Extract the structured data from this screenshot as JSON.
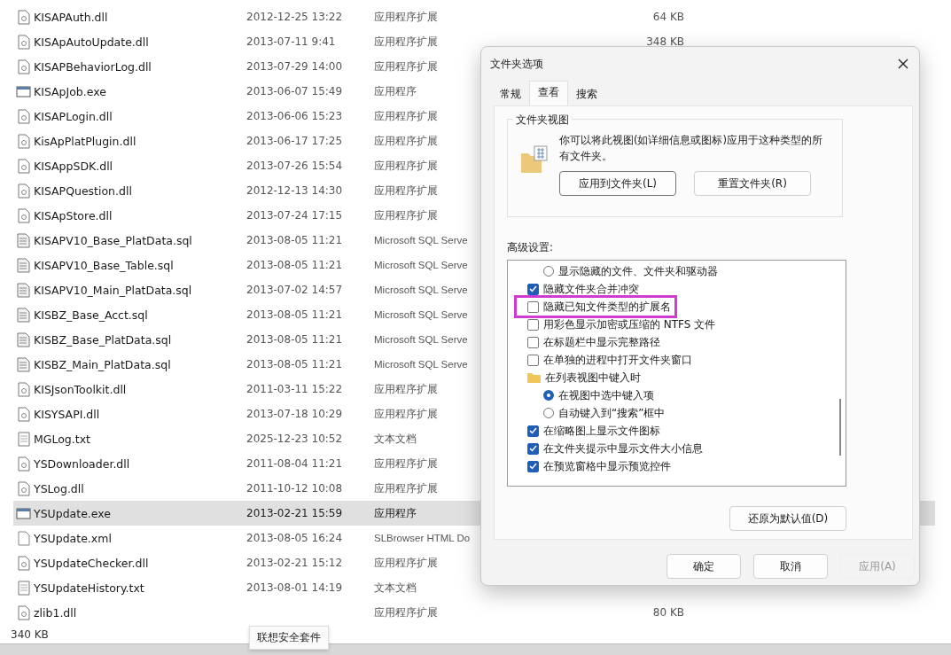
{
  "files": [
    {
      "name": "KISAPAuth.dll",
      "kind": "dll",
      "date": "2012-12-25 13:22",
      "type": "应用程序扩展",
      "size": "64 KB",
      "selected": false
    },
    {
      "name": "KISApAutoUpdate.dll",
      "kind": "dll",
      "date": "2013-07-11 9:41",
      "type": "应用程序扩展",
      "size": "348 KB",
      "selected": false
    },
    {
      "name": "KISAPBehaviorLog.dll",
      "kind": "dll",
      "date": "2013-07-29 14:00",
      "type": "应用程序扩展",
      "selected": false
    },
    {
      "name": "KISApJob.exe",
      "kind": "exe",
      "date": "2013-06-07 15:49",
      "type": "应用程序",
      "selected": false
    },
    {
      "name": "KISAPLogin.dll",
      "kind": "dll",
      "date": "2013-06-06 15:23",
      "type": "应用程序扩展",
      "selected": false
    },
    {
      "name": "KisApPlatPlugin.dll",
      "kind": "dll",
      "date": "2013-06-17 17:25",
      "type": "应用程序扩展",
      "selected": false
    },
    {
      "name": "KISAppSDK.dll",
      "kind": "dll",
      "date": "2013-07-26 15:54",
      "type": "应用程序扩展",
      "selected": false
    },
    {
      "name": "KISAPQuestion.dll",
      "kind": "dll",
      "date": "2012-12-13 14:30",
      "type": "应用程序扩展",
      "selected": false
    },
    {
      "name": "KISApStore.dll",
      "kind": "dll",
      "date": "2013-07-24 17:15",
      "type": "应用程序扩展",
      "selected": false
    },
    {
      "name": "KISAPV10_Base_PlatData.sql",
      "kind": "sql",
      "date": "2013-08-05 11:21",
      "type": "Microsoft SQL Serve",
      "selected": false
    },
    {
      "name": "KISAPV10_Base_Table.sql",
      "kind": "sql",
      "date": "2013-08-05 11:21",
      "type": "Microsoft SQL Serve",
      "selected": false
    },
    {
      "name": "KISAPV10_Main_PlatData.sql",
      "kind": "sql",
      "date": "2013-07-02 14:57",
      "type": "Microsoft SQL Serve",
      "selected": false
    },
    {
      "name": "KISBZ_Base_Acct.sql",
      "kind": "sql",
      "date": "2013-08-05 11:21",
      "type": "Microsoft SQL Serve",
      "selected": false
    },
    {
      "name": "KISBZ_Base_PlatData.sql",
      "kind": "sql",
      "date": "2013-08-05 11:21",
      "type": "Microsoft SQL Serve",
      "selected": false
    },
    {
      "name": "KISBZ_Main_PlatData.sql",
      "kind": "sql",
      "date": "2013-08-05 11:21",
      "type": "Microsoft SQL Serve",
      "selected": false
    },
    {
      "name": "KISJsonToolkit.dll",
      "kind": "dll",
      "date": "2011-03-11 15:22",
      "type": "应用程序扩展",
      "selected": false
    },
    {
      "name": "KISYSAPI.dll",
      "kind": "dll",
      "date": "2013-07-18 10:29",
      "type": "应用程序扩展",
      "selected": false
    },
    {
      "name": "MGLog.txt",
      "kind": "txt",
      "date": "2025-12-23 10:52",
      "type": "文本文档",
      "selected": false
    },
    {
      "name": "YSDownloader.dll",
      "kind": "dll",
      "date": "2011-08-04 11:21",
      "type": "应用程序扩展",
      "selected": false
    },
    {
      "name": "YSLog.dll",
      "kind": "dll",
      "date": "2011-10-12 10:08",
      "type": "应用程序扩展",
      "selected": false
    },
    {
      "name": "YSUpdate.exe",
      "kind": "exe",
      "date": "2013-02-21 15:59",
      "type": "应用程序",
      "selected": true
    },
    {
      "name": "YSUpdate.xml",
      "kind": "xml",
      "date": "2013-08-05 16:24",
      "type": "SLBrowser HTML Do",
      "selected": false
    },
    {
      "name": "YSUpdateChecker.dll",
      "kind": "dll",
      "date": "2013-02-21 15:12",
      "type": "应用程序扩展",
      "selected": false
    },
    {
      "name": "YSUpdateHistory.txt",
      "kind": "txt",
      "date": "2013-08-01 14:19",
      "type": "文本文档",
      "selected": false
    },
    {
      "name": "zlib1.dll",
      "kind": "dll",
      "type": "应用程序扩展",
      "size": "80 KB",
      "selected": false
    }
  ],
  "status_bar": {
    "size": "340 KB"
  },
  "tooltip": "联想安全套件",
  "dialog": {
    "title": "文件夹选项",
    "tabs": [
      {
        "label": "常规",
        "selected": false
      },
      {
        "label": "查看",
        "selected": true
      },
      {
        "label": "搜索",
        "selected": false
      }
    ],
    "folder_views": {
      "title": "文件夹视图",
      "text": "你可以将此视图(如详细信息或图标)应用于这种类型的所有文件夹。",
      "buttons": [
        "应用到文件夹(L)",
        "重置文件夹(R)"
      ]
    },
    "advanced_label": "高级设置:",
    "settings": [
      {
        "kind": "radio",
        "label": "显示隐藏的文件、文件夹和驱动器",
        "checked": false,
        "highlighted": false
      },
      {
        "kind": "checkbox",
        "label": "隐藏文件夹合并冲突",
        "checked": true,
        "highlighted": false
      },
      {
        "kind": "checkbox",
        "label": "隐藏已知文件类型的扩展名",
        "checked": false,
        "highlighted": true
      },
      {
        "kind": "checkbox",
        "label": "用彩色显示加密或压缩的 NTFS 文件",
        "checked": false,
        "highlighted": false
      },
      {
        "kind": "checkbox",
        "label": "在标题栏中显示完整路径",
        "checked": false,
        "highlighted": false
      },
      {
        "kind": "checkbox",
        "label": "在单独的进程中打开文件夹窗口",
        "checked": false,
        "highlighted": false
      },
      {
        "kind": "folder",
        "label": "在列表视图中键入时",
        "highlighted": false,
        "children": [
          {
            "kind": "radio",
            "label": "在视图中选中键入项",
            "checked": true,
            "highlighted": false
          },
          {
            "kind": "radio",
            "label": "自动键入到“搜索”框中",
            "checked": false,
            "highlighted": false
          }
        ]
      },
      {
        "kind": "checkbox",
        "label": "在缩略图上显示文件图标",
        "checked": true,
        "highlighted": false
      },
      {
        "kind": "checkbox",
        "label": "在文件夹提示中显示文件大小信息",
        "checked": true,
        "highlighted": false
      },
      {
        "kind": "checkbox",
        "label": "在预览窗格中显示预览控件",
        "checked": true,
        "highlighted": false
      }
    ],
    "restore_button": "还原为默认值(D)",
    "buttons": [
      {
        "label": "确定",
        "disabled": false
      },
      {
        "label": "取消",
        "disabled": false
      },
      {
        "label": "应用(A)",
        "disabled": true
      }
    ]
  }
}
